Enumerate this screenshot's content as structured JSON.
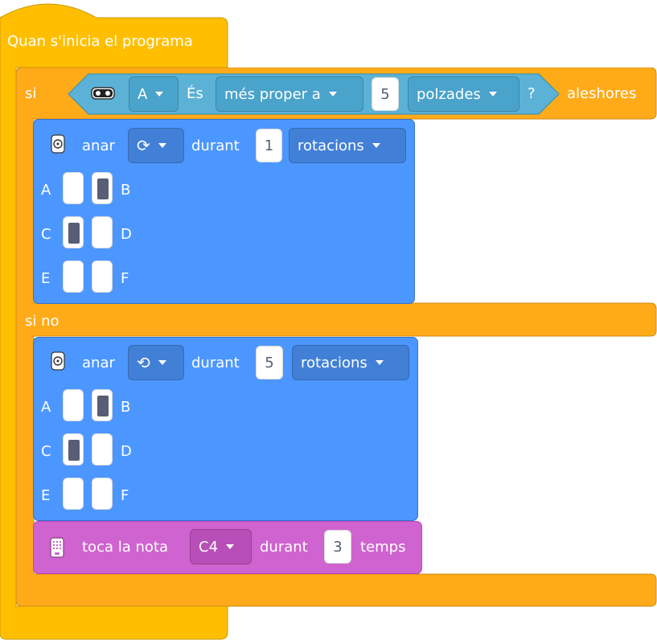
{
  "colors": {
    "event": "#ffbf00",
    "control": "#ffab19",
    "sensor": "#5cb1d6",
    "motion": "#4c97ff",
    "sound": "#cf63cf",
    "port_on": "#575e75"
  },
  "hat": {
    "label": "Quan s'inicia el programa"
  },
  "if_block": {
    "si": "si",
    "aleshores": "aleshores",
    "si_no": "si no",
    "condition": {
      "icon": "distance-sensor-icon",
      "port": "A",
      "es": "És",
      "comparison": "més proper a",
      "value": "5",
      "unit": "polzades",
      "question": "?"
    }
  },
  "motor_block_1": {
    "icon": "dual-motor-icon",
    "anar": "anar",
    "direction_icon": "rotate-clockwise-icon",
    "durant": "durant",
    "value": "1",
    "unit": "rotacions",
    "ports": [
      {
        "label": "A",
        "on": false
      },
      {
        "label": "B",
        "on": true
      },
      {
        "label": "C",
        "on": true
      },
      {
        "label": "D",
        "on": false
      },
      {
        "label": "E",
        "on": false
      },
      {
        "label": "F",
        "on": false
      }
    ]
  },
  "motor_block_2": {
    "icon": "dual-motor-icon",
    "anar": "anar",
    "direction_icon": "rotate-counterclockwise-icon",
    "durant": "durant",
    "value": "5",
    "unit": "rotacions",
    "ports": [
      {
        "label": "A",
        "on": false
      },
      {
        "label": "B",
        "on": true
      },
      {
        "label": "C",
        "on": true
      },
      {
        "label": "D",
        "on": false
      },
      {
        "label": "E",
        "on": false
      },
      {
        "label": "F",
        "on": false
      }
    ]
  },
  "sound_block": {
    "icon": "hub-speaker-icon",
    "label": "toca la nota",
    "note": "C4",
    "durant": "durant",
    "value": "3",
    "unit": "temps"
  }
}
